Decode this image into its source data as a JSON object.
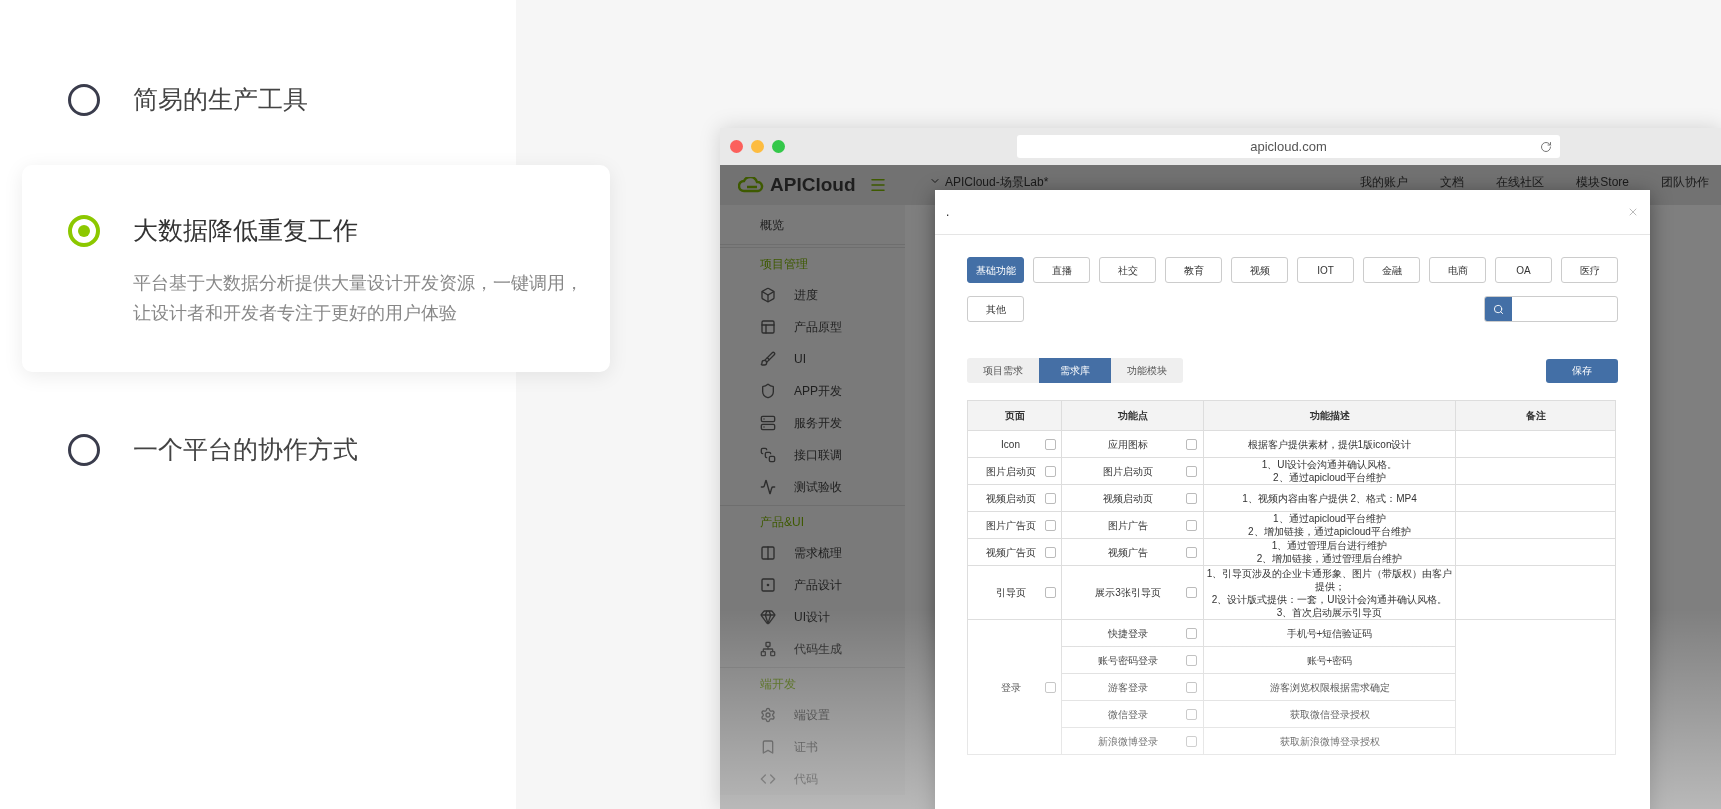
{
  "features": [
    {
      "title": "简易的生产工具",
      "selected": false
    },
    {
      "title": "大数据降低重复工作",
      "description": "平台基于大数据分析提供大量设计开发资源，一键调用，让设计者和开发者专注于更好的用户体验",
      "selected": true
    },
    {
      "title": "一个平台的协作方式",
      "selected": false
    }
  ],
  "browser": {
    "url": "apicloud.com",
    "app": {
      "logo": "APICloud",
      "project": "APICloud-场景Lab*",
      "nav": [
        "我的账户",
        "文档",
        "在线社区",
        "模块Store",
        "团队协作"
      ],
      "sidebar": [
        {
          "kind": "link",
          "label": "概览"
        },
        {
          "kind": "section",
          "label": "项目管理"
        },
        {
          "kind": "item",
          "label": "进度"
        },
        {
          "kind": "item",
          "label": "产品原型"
        },
        {
          "kind": "item",
          "label": "UI"
        },
        {
          "kind": "item",
          "label": "APP开发"
        },
        {
          "kind": "item",
          "label": "服务开发"
        },
        {
          "kind": "item",
          "label": "接口联调"
        },
        {
          "kind": "item",
          "label": "测试验收"
        },
        {
          "kind": "section",
          "label": "产品&UI"
        },
        {
          "kind": "item",
          "label": "需求梳理"
        },
        {
          "kind": "item",
          "label": "产品设计"
        },
        {
          "kind": "item",
          "label": "UI设计"
        },
        {
          "kind": "item",
          "label": "代码生成"
        },
        {
          "kind": "section",
          "label": "端开发"
        },
        {
          "kind": "item",
          "label": "端设置"
        },
        {
          "kind": "item",
          "label": "证书"
        },
        {
          "kind": "item",
          "label": "代码"
        }
      ]
    },
    "modal": {
      "title": ".",
      "categories": [
        {
          "label": "基础功能",
          "selected": true
        },
        {
          "label": "直播",
          "selected": false
        },
        {
          "label": "社交",
          "selected": false
        },
        {
          "label": "教育",
          "selected": false
        },
        {
          "label": "视频",
          "selected": false
        },
        {
          "label": "IOT",
          "selected": false
        },
        {
          "label": "金融",
          "selected": false
        },
        {
          "label": "电商",
          "selected": false
        },
        {
          "label": "OA",
          "selected": false
        },
        {
          "label": "医疗",
          "selected": false
        },
        {
          "label": "其他",
          "selected": false
        }
      ],
      "tabs": [
        {
          "label": "项目需求",
          "selected": false
        },
        {
          "label": "需求库",
          "selected": true
        },
        {
          "label": "功能模块",
          "selected": false
        }
      ],
      "save": "保存",
      "columns": [
        "页面",
        "功能点",
        "功能描述",
        "备注"
      ],
      "rows": [
        {
          "page": "Icon",
          "checked": false,
          "functions": [
            {
              "name": "应用图标",
              "checked": false,
              "description": "根据客户提供素材，提供1版icon设计"
            }
          ]
        },
        {
          "page": "图片启动页",
          "checked": false,
          "functions": [
            {
              "name": "图片启动页",
              "checked": false,
              "description": "1、UI设计会沟通并确认风格。\n2、通过apicloud平台维护"
            }
          ]
        },
        {
          "page": "视频启动页",
          "checked": false,
          "functions": [
            {
              "name": "视频启动页",
              "checked": false,
              "description": "1、视频内容由客户提供 2、格式：MP4"
            }
          ]
        },
        {
          "page": "图片广告页",
          "checked": false,
          "functions": [
            {
              "name": "图片广告",
              "checked": false,
              "description": "1、通过apicloud平台维护\n2、增加链接，通过apicloud平台维护"
            }
          ]
        },
        {
          "page": "视频广告页",
          "checked": false,
          "functions": [
            {
              "name": "视频广告",
              "checked": false,
              "description": "1、通过管理后台进行维护\n2、增加链接，通过管理后台维护"
            }
          ]
        },
        {
          "page": "引导页",
          "checked": false,
          "functions": [
            {
              "name": "展示3张引导页",
              "checked": false,
              "description": "1、引导页涉及的企业卡通形象、图片（带版权）由客户提供；\n2、设计版式提供：一套，UI设计会沟通并确认风格。3、首次启动展示引导页"
            }
          ]
        },
        {
          "page": "登录",
          "checked": false,
          "functions": [
            {
              "name": "快捷登录",
              "checked": false,
              "description": "手机号+短信验证码"
            },
            {
              "name": "账号密码登录",
              "checked": false,
              "description": "账号+密码"
            },
            {
              "name": "游客登录",
              "checked": false,
              "description": "游客浏览权限根据需求确定"
            },
            {
              "name": "微信登录",
              "checked": false,
              "description": "获取微信登录授权"
            },
            {
              "name": "新浪微博登录",
              "checked": false,
              "description": "获取新浪微博登录授权"
            }
          ]
        }
      ]
    }
  }
}
